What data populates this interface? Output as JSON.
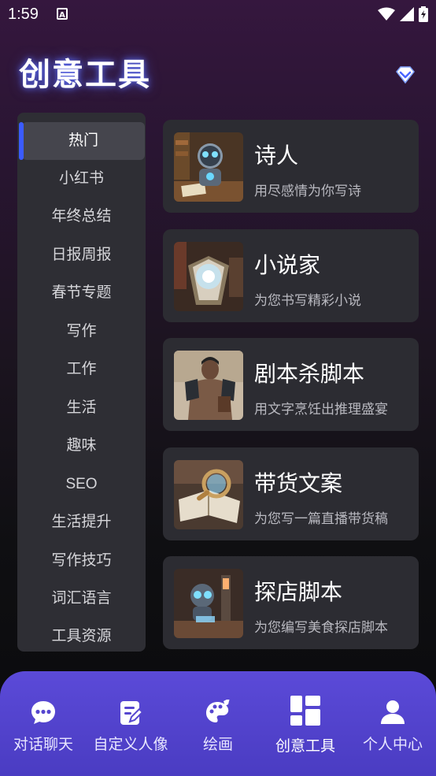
{
  "status_bar": {
    "time": "1:59",
    "notification_glyph": "A"
  },
  "header": {
    "title": "创意工具"
  },
  "sidebar": {
    "items": [
      {
        "label": "热门",
        "active": true
      },
      {
        "label": "小红书"
      },
      {
        "label": "年终总结"
      },
      {
        "label": "日报周报"
      },
      {
        "label": "春节专题"
      },
      {
        "label": "写作"
      },
      {
        "label": "工作"
      },
      {
        "label": "生活"
      },
      {
        "label": "趣味"
      },
      {
        "label": "SEO"
      },
      {
        "label": "生活提升"
      },
      {
        "label": "写作技巧"
      },
      {
        "label": "词汇语言"
      },
      {
        "label": "工具资源"
      }
    ]
  },
  "tools": [
    {
      "title": "诗人",
      "subtitle": "用尽感情为你写诗",
      "icon": "poet-robot-image"
    },
    {
      "title": "小说家",
      "subtitle": "为您书写精彩小说",
      "icon": "glowing-book-image"
    },
    {
      "title": "剧本杀脚本",
      "subtitle": "用文字烹饪出推理盛宴",
      "icon": "warrior-figure-image"
    },
    {
      "title": "带货文案",
      "subtitle": "为您写一篇直播带货稿",
      "icon": "magnifier-book-image"
    },
    {
      "title": "探店脚本",
      "subtitle": "为您编写美食探店脚本",
      "icon": "explorer-robot-image"
    }
  ],
  "bottom_nav": {
    "items": [
      {
        "label": "对话聊天",
        "icon": "chat-bubble-icon"
      },
      {
        "label": "自定义人像",
        "icon": "edit-document-icon"
      },
      {
        "label": "绘画",
        "icon": "palette-icon"
      },
      {
        "label": "创意工具",
        "icon": "grid-tools-icon",
        "active": true
      },
      {
        "label": "个人中心",
        "icon": "person-icon"
      }
    ]
  },
  "colors": {
    "accent": "#3b5bff",
    "nav_bg": "#5b4ad8",
    "card_bg": "#2c2c32",
    "sidebar_bg": "#2e2e34"
  }
}
